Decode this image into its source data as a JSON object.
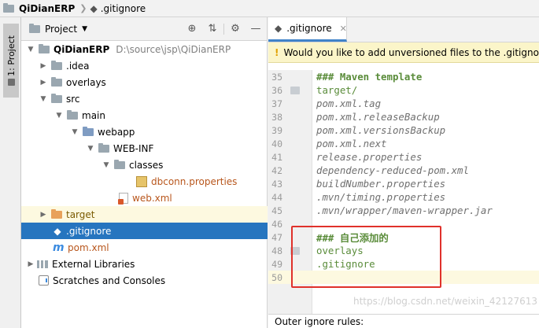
{
  "breadcrumb": {
    "project": "QiDianERP",
    "file": ".gitignore"
  },
  "sidebar": {
    "tab_label": "1: Project"
  },
  "project_panel": {
    "title": "Project",
    "tree": [
      {
        "label": "QiDianERP",
        "path": "D:\\source\\jsp\\QiDianERP"
      },
      {
        "label": ".idea"
      },
      {
        "label": "overlays"
      },
      {
        "label": "src"
      },
      {
        "label": "main"
      },
      {
        "label": "webapp"
      },
      {
        "label": "WEB-INF"
      },
      {
        "label": "classes"
      },
      {
        "label": "dbconn.properties"
      },
      {
        "label": "web.xml"
      },
      {
        "label": "target"
      },
      {
        "label": ".gitignore"
      },
      {
        "label": "pom.xml"
      },
      {
        "label": "External Libraries"
      },
      {
        "label": "Scratches and Consoles"
      }
    ]
  },
  "editor": {
    "tab_label": ".gitignore",
    "notice": "Would you like to add unversioned files to the .gitignore",
    "lines": [
      {
        "num": "35",
        "text": "### Maven template"
      },
      {
        "num": "36",
        "text": "target/"
      },
      {
        "num": "37",
        "text": "pom.xml.tag"
      },
      {
        "num": "38",
        "text": "pom.xml.releaseBackup"
      },
      {
        "num": "39",
        "text": "pom.xml.versionsBackup"
      },
      {
        "num": "40",
        "text": "pom.xml.next"
      },
      {
        "num": "41",
        "text": "release.properties"
      },
      {
        "num": "42",
        "text": "dependency-reduced-pom.xml"
      },
      {
        "num": "43",
        "text": "buildNumber.properties"
      },
      {
        "num": "44",
        "text": ".mvn/timing.properties"
      },
      {
        "num": "45",
        "text": ".mvn/wrapper/maven-wrapper.jar"
      },
      {
        "num": "46",
        "text": ""
      },
      {
        "num": "47",
        "text": "### 自己添加的"
      },
      {
        "num": "48",
        "text": "overlays"
      },
      {
        "num": "49",
        "text": ".gitignore"
      },
      {
        "num": "50",
        "text": ""
      }
    ],
    "outer_rules_label": "Outer ignore rules:"
  },
  "watermark": "https://blog.csdn.net/weixin_42127613",
  "colors": {
    "selection": "#2675bf",
    "highlight_box": "#e0312b",
    "notice_bg": "#fbf5c9"
  }
}
